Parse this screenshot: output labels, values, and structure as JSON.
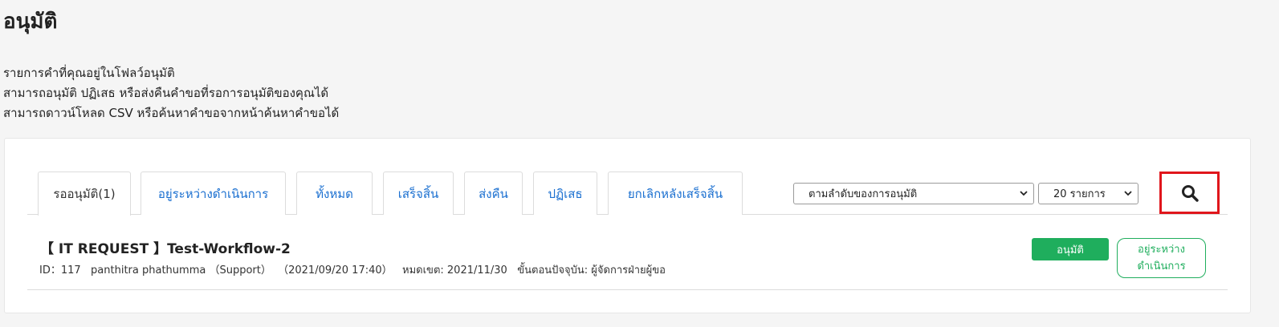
{
  "page": {
    "title": "อนุมัติ",
    "description": [
      "รายการคำที่คุณอยู่ในโฟลว์อนุมัติ",
      "สามารถอนุมัติ ปฏิเสธ หรือส่งคืนคำขอที่รอการอนุมัติของคุณได้",
      "สามารถดาวน์โหลด CSV หรือค้นหาคำขอจากหน้าค้นหาคำขอได้"
    ]
  },
  "tabs": [
    {
      "label": "รออนุมัติ(1)",
      "active": true
    },
    {
      "label": "อยู่ระหว่างดำเนินการ",
      "active": false
    },
    {
      "label": "ทั้งหมด",
      "active": false
    },
    {
      "label": "เสร็จสิ้น",
      "active": false
    },
    {
      "label": "ส่งคืน",
      "active": false
    },
    {
      "label": "ปฏิเสธ",
      "active": false
    },
    {
      "label": "ยกเลิกหลังเสร็จสิ้น",
      "active": false
    }
  ],
  "filters": {
    "sort_selected": "ตามลำดับของการอนุมัติ",
    "per_page_selected": "20 รายการ"
  },
  "icons": {
    "search": "search-icon",
    "dropdown": "chevron-down-icon"
  },
  "request": {
    "title": "【 IT REQUEST 】Test-Workflow-2",
    "meta": "ID：117   panthitra phathumma （Support）  （2021/09/20 17:40）   หมดเขต: 2021/11/30   ขั้นตอนปัจจุบัน: ผู้จัดการฝ่ายผู้ขอ",
    "approve_label": "อนุมัติ",
    "status_line1": "อยู่ระหว่าง",
    "status_line2": "ดำเนินการ"
  },
  "colors": {
    "link": "#1a6fd0",
    "approve": "#1fae5d",
    "highlight": "#e0161c"
  }
}
